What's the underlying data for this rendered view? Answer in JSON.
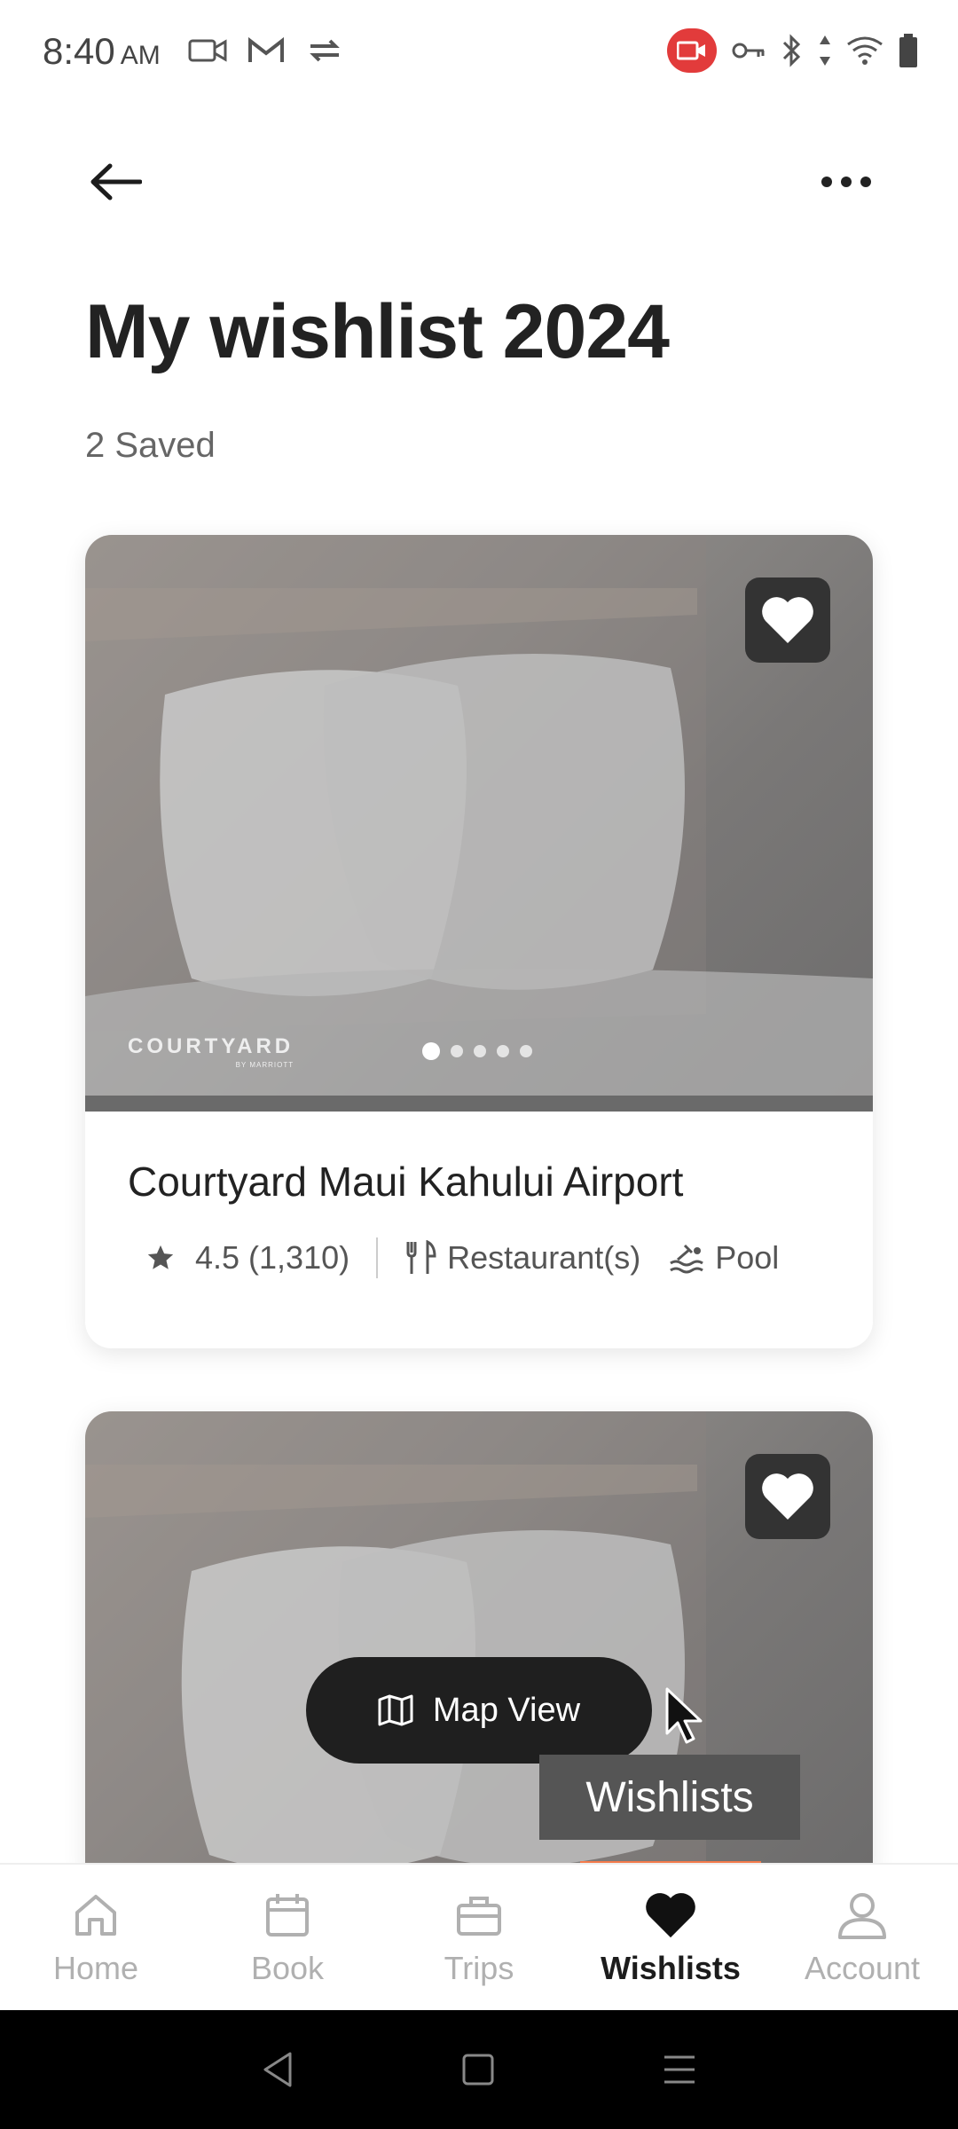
{
  "status_bar": {
    "time": "8:40",
    "ampm": "AM"
  },
  "header": {
    "title": "My wishlist 2024",
    "saved_count": "2 Saved"
  },
  "cards": [
    {
      "brand": "COURTYARD",
      "brand_sub": "BY MARRIOTT",
      "name": "Courtyard Maui Kahului Airport",
      "rating": "4.5 (1,310)",
      "amenities": [
        "Restaurant(s)",
        "Pool"
      ],
      "carousel_dots": 5,
      "active_dot": 1,
      "saved": true
    },
    {
      "saved": true
    }
  ],
  "map_view": {
    "label": "Map View"
  },
  "tooltip": {
    "text": "Wishlists"
  },
  "bottom_nav": {
    "items": [
      {
        "label": "Home",
        "icon": "home-icon",
        "active": false
      },
      {
        "label": "Book",
        "icon": "calendar-icon",
        "active": false
      },
      {
        "label": "Trips",
        "icon": "briefcase-icon",
        "active": false
      },
      {
        "label": "Wishlists",
        "icon": "heart-icon",
        "active": true
      },
      {
        "label": "Account",
        "icon": "person-icon",
        "active": false
      }
    ]
  },
  "colors": {
    "accent": "#f47b4b",
    "text_primary": "#1c1c1c",
    "nav_inactive": "#b0b0b0",
    "dark_button": "#1f1f1f",
    "recording_badge": "#e23b3b"
  }
}
